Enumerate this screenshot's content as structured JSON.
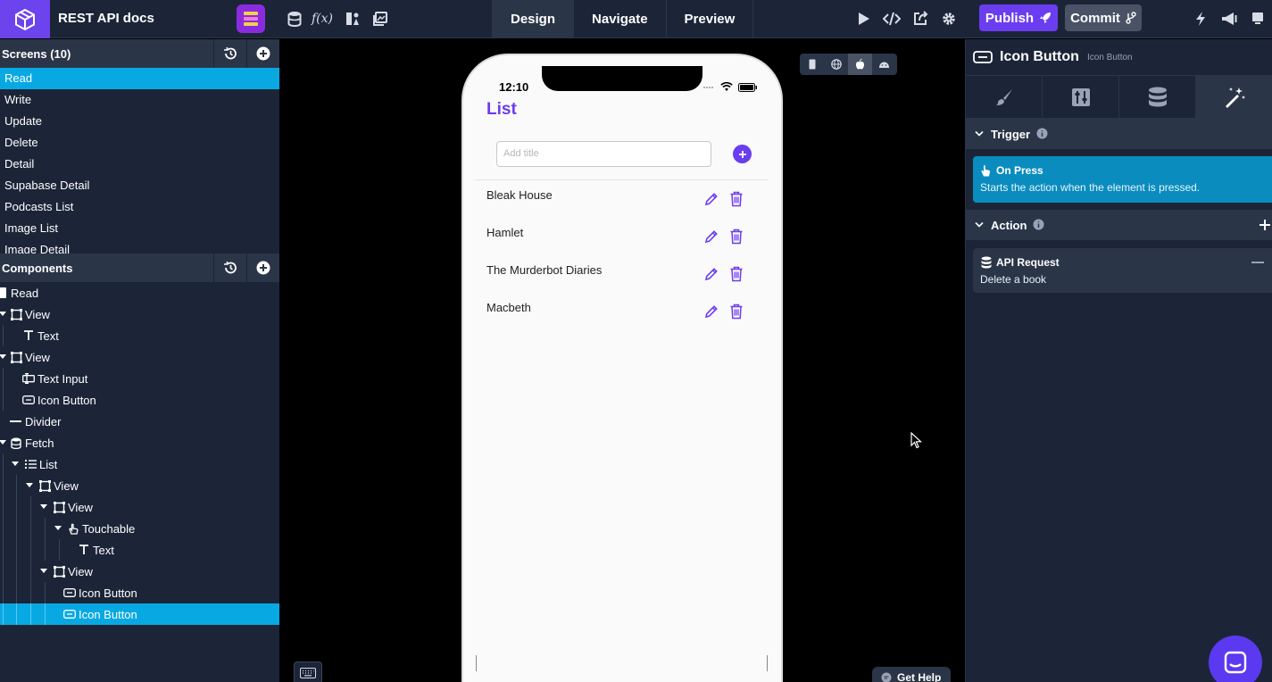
{
  "app": {
    "title": "REST API docs"
  },
  "mode_tabs": [
    {
      "label": "Design",
      "active": true
    },
    {
      "label": "Navigate",
      "active": false
    },
    {
      "label": "Preview",
      "active": false
    }
  ],
  "toolbar": {
    "publish_label": "Publish",
    "commit_label": "Commit"
  },
  "screens": {
    "header": "Screens (10)",
    "items": [
      {
        "label": "Read",
        "active": true
      },
      {
        "label": "Write"
      },
      {
        "label": "Update"
      },
      {
        "label": "Delete"
      },
      {
        "label": "Detail"
      },
      {
        "label": "Supabase Detail"
      },
      {
        "label": "Podcasts List"
      },
      {
        "label": "Image List"
      },
      {
        "label": "Image Detail"
      }
    ]
  },
  "components": {
    "header": "Components",
    "tree": [
      {
        "label": "Read",
        "icon": "screen-icon"
      },
      {
        "label": "View",
        "icon": "view-icon"
      },
      {
        "label": "Text",
        "icon": "text-icon"
      },
      {
        "label": "View",
        "icon": "view-icon"
      },
      {
        "label": "Text Input",
        "icon": "text-input-icon"
      },
      {
        "label": "Icon Button",
        "icon": "icon-button-icon"
      },
      {
        "label": "Divider",
        "icon": "divider-icon"
      },
      {
        "label": "Fetch",
        "icon": "fetch-icon"
      },
      {
        "label": "List",
        "icon": "list-icon"
      },
      {
        "label": "View",
        "icon": "view-icon"
      },
      {
        "label": "View",
        "icon": "view-icon"
      },
      {
        "label": "Touchable",
        "icon": "touchable-icon"
      },
      {
        "label": "Text",
        "icon": "text-icon"
      },
      {
        "label": "View",
        "icon": "view-icon"
      },
      {
        "label": "Icon Button",
        "icon": "icon-button-icon"
      },
      {
        "label": "Icon Button",
        "icon": "icon-button-icon",
        "active": true
      }
    ]
  },
  "phone": {
    "time": "12:10",
    "title": "List",
    "input_placeholder": "Add title",
    "books": [
      "Bleak House",
      "Hamlet",
      "The Murderbot Diaries",
      "Macbeth"
    ],
    "accent": "#6b3df0"
  },
  "canvas": {
    "help_label": "Get Help"
  },
  "inspector": {
    "title": "Icon Button",
    "subtitle": "Icon Button",
    "trigger_header": "Trigger",
    "trigger_title": "On Press",
    "trigger_desc": "Starts the action when the element is pressed.",
    "action_header": "Action",
    "action_title": "API Request",
    "action_desc": "Delete a book"
  },
  "colors": {
    "panel": "#1c2538",
    "header": "#2b3548",
    "selected": "#08a9e3",
    "brand": "#6c43ec"
  }
}
